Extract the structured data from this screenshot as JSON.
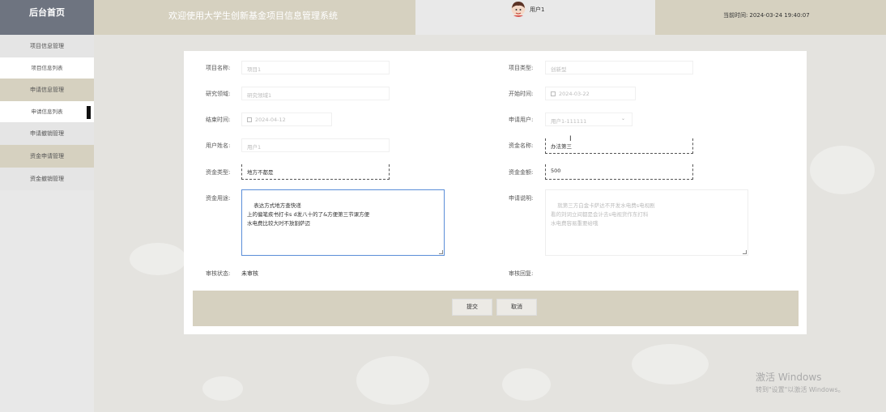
{
  "header": {
    "logo": "后台首页",
    "title": "欢迎使用大学生创新基金项目信息管理系统",
    "username": "用户1",
    "time_label": "当前时间:",
    "time_value": "2024-03-24 19:40:07"
  },
  "sidebar": {
    "items": [
      {
        "label": "项目信息管理"
      },
      {
        "label": "项目信息列表"
      },
      {
        "label": "申请信息管理"
      },
      {
        "label": "申请信息列表"
      },
      {
        "label": "申请撤销管理"
      },
      {
        "label": "资金申请管理"
      },
      {
        "label": "资金撤销管理"
      }
    ]
  },
  "form": {
    "project_name": {
      "label": "项目名称:",
      "value": "项目1"
    },
    "project_type": {
      "label": "项目类型:",
      "value": "创新型"
    },
    "research_field": {
      "label": "研究领域:",
      "value": "研究领域1"
    },
    "start_time": {
      "label": "开始时间:",
      "value": "2024-03-22"
    },
    "end_time": {
      "label": "结束时间:",
      "value": "2024-04-12"
    },
    "apply_user": {
      "label": "申请用户:",
      "value": "用户1-111111"
    },
    "user_name": {
      "label": "用户姓名:",
      "value": "用户1"
    },
    "fund_name": {
      "label": "资金名称:",
      "value": "办法第三"
    },
    "fund_type": {
      "label": "资金类型:",
      "value": "地方不都是"
    },
    "fund_amount": {
      "label": "资金金额:",
      "value": "500"
    },
    "fund_use": {
      "label": "资金用途:",
      "value": "表达方式地方查快递\n上的偏笔疾书打卡s d发八十的了&方便第三节课方便\n水电费比较大时不放割萨迈"
    },
    "apply_desc": {
      "label": "申请说明:",
      "value": "就第三方白金卡萨达不开发水电费s电视剧\n看的刘词立间都是会计去s电视货作东打科\n水电费容易重要给哦"
    },
    "review_status": {
      "label": "审核状态:",
      "value": "未审核"
    },
    "review_reply": {
      "label": "审核回复:"
    }
  },
  "buttons": {
    "submit": "提交",
    "cancel": "取消"
  },
  "watermark": {
    "line1": "激活 Windows",
    "line2": "转到\"设置\"以激活 Windows。"
  },
  "icons": {
    "avatar": "avatar-icon",
    "calendar": "calendar-icon",
    "dropdown": "chevron-down-icon",
    "cursor": "text-cursor-icon"
  }
}
